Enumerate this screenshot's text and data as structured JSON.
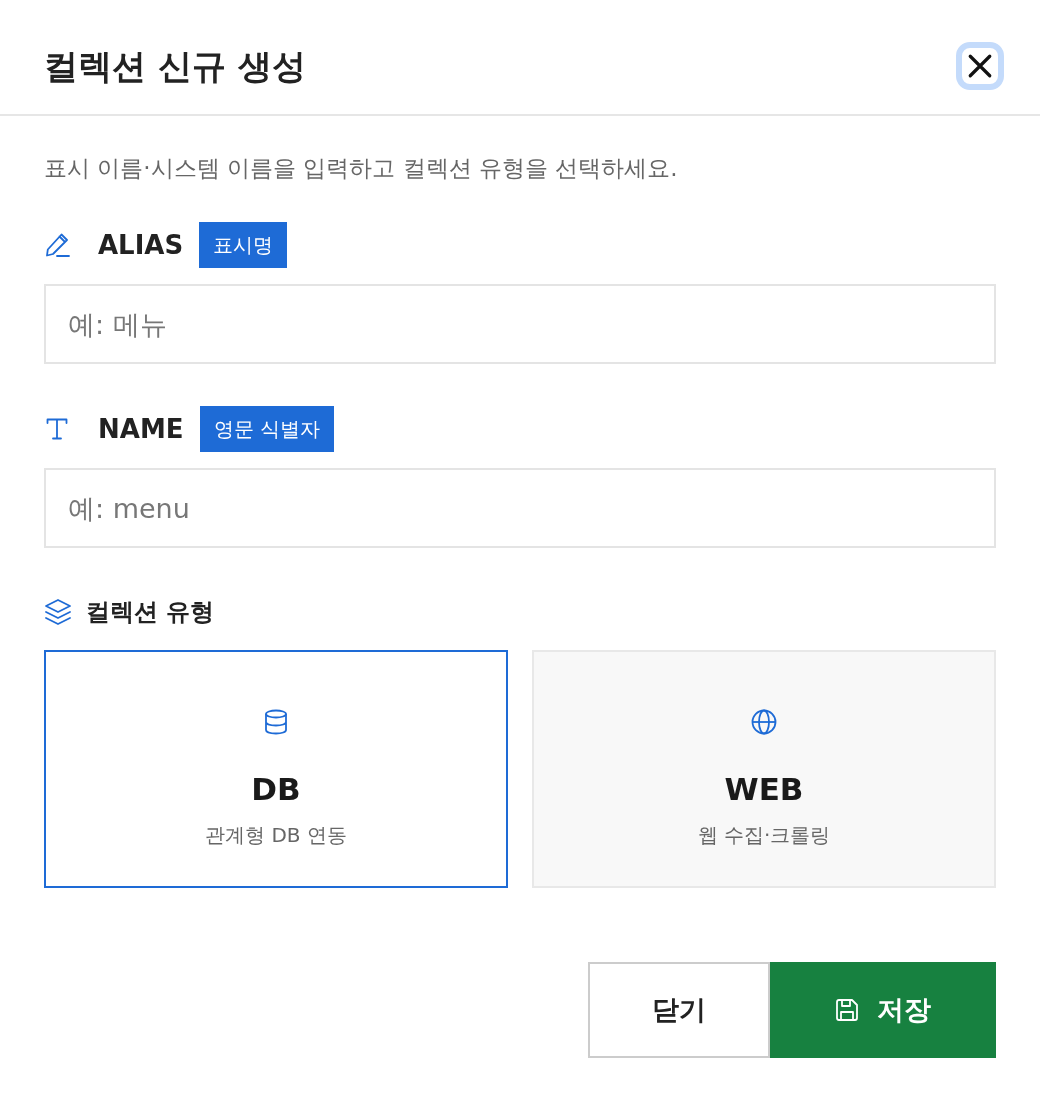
{
  "dialog": {
    "title": "컬렉션 신규 생성",
    "close_button": {
      "focused": true
    }
  },
  "description": "표시 이름·시스템 이름을 입력하고 컬렉션 유형을 선택하세요.",
  "fields": [
    {
      "kind": "alias",
      "label": "ALIAS",
      "badge": "표시명",
      "placeholder": "예: 메뉴"
    },
    {
      "kind": "name",
      "label": "NAME",
      "badge": "영문 식별자",
      "placeholder": "예: menu"
    }
  ],
  "collection_type": {
    "title": "컬렉션 유형",
    "options": [
      {
        "kind": "db",
        "title": "DB",
        "subtitle": "관계형 DB 연동",
        "selected": true
      },
      {
        "kind": "web",
        "title": "WEB",
        "subtitle": "웹 수집·크롤링",
        "selected": false
      }
    ]
  },
  "buttons": [
    {
      "kind": "secondary",
      "label": "닫기"
    },
    {
      "kind": "primary",
      "label": "저장"
    }
  ]
}
